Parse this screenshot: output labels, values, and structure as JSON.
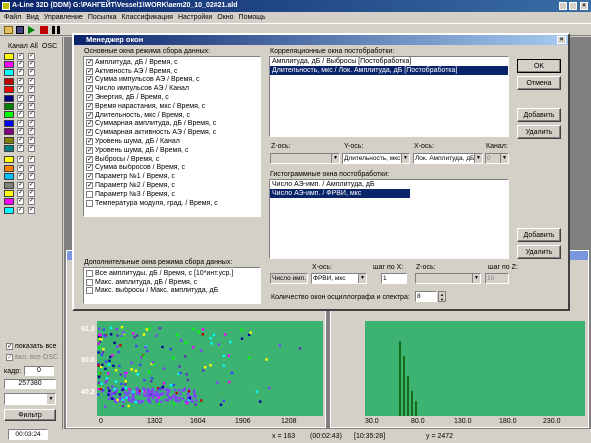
{
  "window_title": "A-Line 32D (DDM) G:\\РАНГЕЙТ\\Vessel1\\WORK\\aem20_10_02#21.ald",
  "menu": [
    "Файл",
    "Вид",
    "Управление",
    "Посылка",
    "Классификация",
    "Настройки",
    "Окно",
    "Помощь"
  ],
  "left_panel": {
    "col_channel": "Канал",
    "col_all": "All",
    "col_osc": "OSC",
    "channels": [
      {
        "n": "1",
        "color": "#ffff00"
      },
      {
        "n": "2",
        "color": "#ff00ff"
      },
      {
        "n": "3",
        "color": "#00ffff"
      },
      {
        "n": "4",
        "color": "#c00000"
      },
      {
        "n": "5",
        "color": "#ff0000"
      },
      {
        "n": "6",
        "color": "#000080"
      },
      {
        "n": "7",
        "color": "#008000"
      },
      {
        "n": "8",
        "color": "#00ff00"
      },
      {
        "n": "9",
        "color": "#0000ff"
      },
      {
        "n": "10",
        "color": "#800080"
      },
      {
        "n": "11",
        "color": "#808000"
      },
      {
        "n": "12",
        "color": "#008080"
      },
      {
        "n": "13",
        "color": "#ffff00"
      },
      {
        "n": "14",
        "color": "#ff8000"
      },
      {
        "n": "15",
        "color": "#00c0ff"
      },
      {
        "n": "16",
        "color": "#808080"
      },
      {
        "n": "17",
        "color": "#ffff00"
      },
      {
        "n": "18",
        "color": "#ff00ff"
      },
      {
        "n": "19",
        "color": "#00ffff"
      }
    ],
    "show_all": "показать все",
    "incl_osc": "вкл. все OSC",
    "frame_label": "кадр:",
    "frame_value": "0",
    "counter": "257380",
    "filter_btn": "Фильтр",
    "time": "00:03:24"
  },
  "dialog": {
    "title": "Менеджер окон",
    "main_group": "Основные окна режима сбора данных:",
    "main_items": [
      {
        "text": "Амплитуда, дБ / Время, с",
        "checked": true
      },
      {
        "text": "Активность АЭ / Время, с",
        "checked": true
      },
      {
        "text": "Сумма импульсов АЭ / Время, с",
        "checked": true
      },
      {
        "text": "Число импульсов АЭ / Канал",
        "checked": true
      },
      {
        "text": "Энергия, дБ / Время, с",
        "checked": true
      },
      {
        "text": "Время нарастания, мкс / Время, с",
        "checked": true
      },
      {
        "text": "Длительность, мкс / Время, с",
        "checked": true
      },
      {
        "text": "Суммарная амплитуда, дБ / Время, с",
        "checked": true
      },
      {
        "text": "Суммарная активность АЭ / Время, с",
        "checked": true
      },
      {
        "text": "Уровень шума, дБ / Канал",
        "checked": true
      },
      {
        "text": "Уровень шума, дБ / Время, с",
        "checked": true
      },
      {
        "text": "Выбросы / Время, с",
        "checked": true
      },
      {
        "text": "Сумма выбросов / Время, с",
        "checked": true
      },
      {
        "text": "Параметр №1 / Время, с",
        "checked": true
      },
      {
        "text": "Параметр №2 / Время, с",
        "checked": true
      },
      {
        "text": "Параметр №3 / Время, с",
        "checked": false
      },
      {
        "text": "Температура модуля, град. / Время, с",
        "checked": false
      }
    ],
    "extra_group": "Дополнительные окна режима сбора данных:",
    "extra_items": [
      {
        "text": "Все амплитуды, дБ / Время, с [10*инт.уср.]",
        "checked": false
      },
      {
        "text": "Макс. амплитуда, дБ / Время, с",
        "checked": false
      },
      {
        "text": "Макс. выбросы / Макс. амплитуда, дБ",
        "checked": false
      }
    ],
    "corr_group": "Корреляционные окна постобработки:",
    "corr_items": [
      "Амплитуда, дБ / Выбросы [Постобработка]",
      "Длительность, мкс / Лок. Амплитуда, дБ [Постобработка]"
    ],
    "z_axis_label": "Z-ось:",
    "y_axis_label": "Y-ось:",
    "x_axis_label": "X-ось:",
    "channel_label": "Канал:",
    "y_axis_value": "Длительность, мкс",
    "x_axis_value": "Лок. Амплитуда, дБ",
    "channel_value": "0",
    "hist_group": "Гистограммные окна постобработки:",
    "hist_items": [
      "Число АЭ-имп. / Амплитуда, дБ",
      "Число АЭ-имп. / ФРВИ, мкс"
    ],
    "hist_xaxis_label": "X-ось:",
    "hist_step_x": "шаг по X:",
    "hist_zaxis_label": "Z-ось:",
    "hist_step_z": "шаг по Z:",
    "hist_y_value": "Число имп.",
    "hist_x_value": "ФРВИ, мкс",
    "hist_step_x_value": "1",
    "hist_step_z_value": "10",
    "osc_count_label": "Количество окон осциллографа и спектра:",
    "osc_count_value": "8",
    "buttons": {
      "ok": "OK",
      "cancel": "Отмена",
      "add": "Добавить",
      "remove": "Удалить"
    }
  },
  "plot_left": {
    "y_ticks": [
      "61.3",
      "50.8",
      "40.2"
    ],
    "x_ticks": [
      "0",
      "1302",
      "1604",
      "1906",
      "1208"
    ]
  },
  "plot_right": {
    "x_ticks": [
      "30.0",
      "80.0",
      "130.0",
      "180.0",
      "230.0"
    ]
  },
  "status": {
    "x": "x = 163",
    "t1": "(00:02:43)",
    "t2": "[10:35:28]",
    "y": "y = 2472"
  }
}
